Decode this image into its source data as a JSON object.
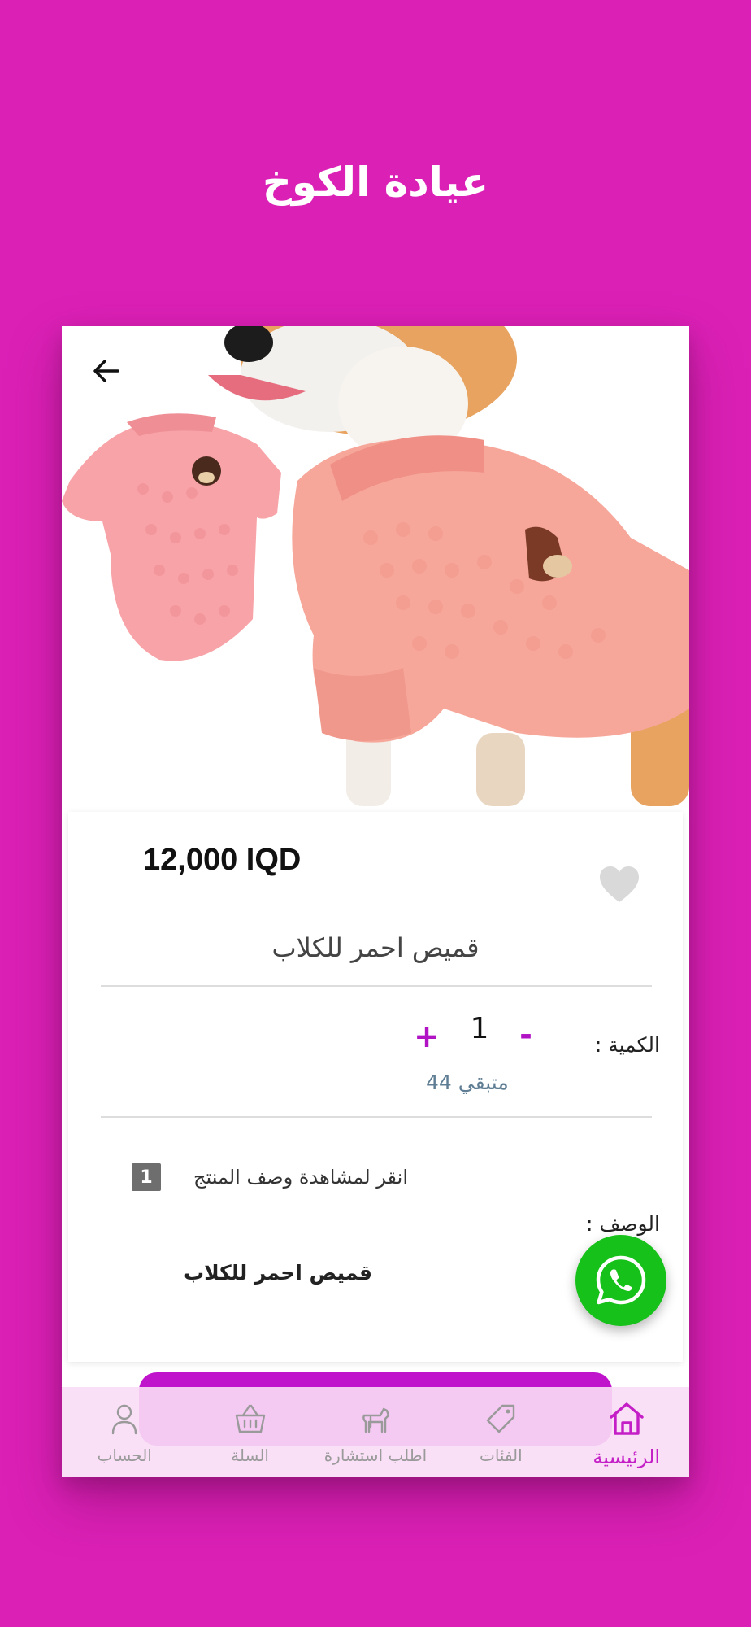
{
  "promo": {
    "title": "عيادة الكوخ"
  },
  "product": {
    "price": "12,000 IQD",
    "name": "قميص احمر للكلاب",
    "quantity_label": "الكمية :",
    "quantity_value": "1",
    "minus": "-",
    "plus": "+",
    "stock": "متبقي 44",
    "description_toggle_label": "انقر لمشاهدة وصف المنتج",
    "description_toggle_badge": "1",
    "description_label": "الوصف :",
    "description_text": "قميص احمر للكلاب"
  },
  "icons": {
    "back": "arrow-left-icon",
    "favorite": "heart-icon",
    "whatsapp": "whatsapp-icon"
  },
  "bottom_nav": {
    "items": [
      {
        "label": "الرئيسية",
        "icon": "home-icon",
        "active": true
      },
      {
        "label": "الفئات",
        "icon": "tag-icon",
        "active": false
      },
      {
        "label": "اطلب استشارة",
        "icon": "pet-icon",
        "active": false
      },
      {
        "label": "السلة",
        "icon": "basket-icon",
        "active": false
      },
      {
        "label": "الحساب",
        "icon": "user-icon",
        "active": false
      }
    ]
  },
  "colors": {
    "background": "#db20b6",
    "accent": "#c014cc",
    "whatsapp": "#16c219",
    "stock": "#5f7e94"
  }
}
